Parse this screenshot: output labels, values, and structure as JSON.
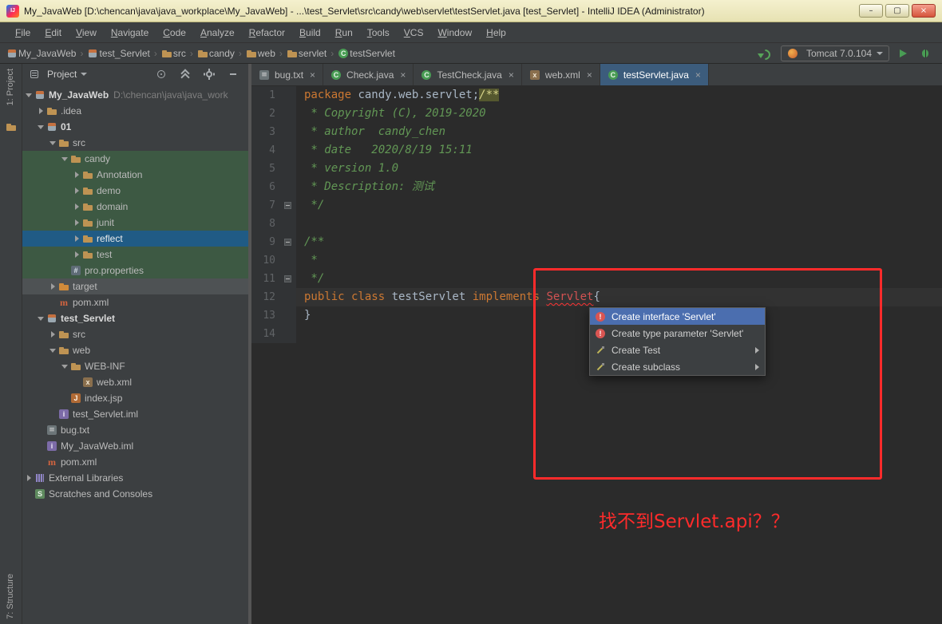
{
  "window": {
    "title": "My_JavaWeb [D:\\chencan\\java\\java_workplace\\My_JavaWeb] - ...\\test_Servlet\\src\\candy\\web\\servlet\\testServlet.java [test_Servlet] - IntelliJ IDEA (Administrator)",
    "controls": {
      "minimize": "–",
      "maximize": "▢",
      "close": "×"
    }
  },
  "menu_bar": {
    "items": [
      "File",
      "Edit",
      "View",
      "Navigate",
      "Code",
      "Analyze",
      "Refactor",
      "Build",
      "Run",
      "Tools",
      "VCS",
      "Window",
      "Help"
    ]
  },
  "nav_bar": {
    "breadcrumbs": [
      {
        "label": "My_JavaWeb",
        "icon": "module"
      },
      {
        "label": "test_Servlet",
        "icon": "module"
      },
      {
        "label": "src",
        "icon": "folder"
      },
      {
        "label": "candy",
        "icon": "folder"
      },
      {
        "label": "web",
        "icon": "folder"
      },
      {
        "label": "servlet",
        "icon": "folder"
      },
      {
        "label": "testServlet",
        "icon": "class"
      }
    ],
    "right": {
      "pre_icons": [
        "green-arrow"
      ],
      "run_config": {
        "label": "Tomcat 7.0.104",
        "icon": "tomcat"
      },
      "post_icons": [
        "run",
        "debug"
      ]
    }
  },
  "tool_windows": {
    "left_top": "1: Project",
    "left_bottom": "7: Structure"
  },
  "project_panel": {
    "header": {
      "icon": "project-view",
      "title": "Project",
      "actions": [
        "locate",
        "collapse-all",
        "settings",
        "hide"
      ]
    },
    "tree": [
      {
        "label": "My_JavaWeb",
        "hint": "D:\\chencan\\java\\java_work",
        "indent": 0,
        "icon": "module",
        "arrow": "down",
        "bold": true
      },
      {
        "label": ".idea",
        "indent": 1,
        "icon": "folder",
        "arrow": "right"
      },
      {
        "label": "01",
        "indent": 1,
        "icon": "module",
        "arrow": "down",
        "bold": true
      },
      {
        "label": "src",
        "indent": 2,
        "icon": "folder",
        "arrow": "down"
      },
      {
        "label": "candy",
        "indent": 3,
        "icon": "folder",
        "arrow": "down",
        "highlight": "green"
      },
      {
        "label": "Annotation",
        "indent": 4,
        "icon": "folder",
        "arrow": "right",
        "highlight": "green"
      },
      {
        "label": "demo",
        "indent": 4,
        "icon": "folder",
        "arrow": "right",
        "highlight": "green"
      },
      {
        "label": "domain",
        "indent": 4,
        "icon": "folder",
        "arrow": "right",
        "highlight": "green"
      },
      {
        "label": "junit",
        "indent": 4,
        "icon": "folder",
        "arrow": "right",
        "highlight": "green"
      },
      {
        "label": "reflect",
        "indent": 4,
        "icon": "folder",
        "arrow": "right",
        "highlight": "blue"
      },
      {
        "label": "test",
        "indent": 4,
        "icon": "folder",
        "arrow": "right",
        "highlight": "green"
      },
      {
        "label": "pro.properties",
        "indent": 3,
        "icon": "properties",
        "highlight": "green"
      },
      {
        "label": "target",
        "indent": 2,
        "icon": "folder-orange",
        "arrow": "right",
        "highlight": "gray"
      },
      {
        "label": "pom.xml",
        "indent": 2,
        "icon": "maven"
      },
      {
        "label": "test_Servlet",
        "indent": 1,
        "icon": "module",
        "arrow": "down",
        "bold": true
      },
      {
        "label": "src",
        "indent": 2,
        "icon": "folder",
        "arrow": "right"
      },
      {
        "label": "web",
        "indent": 2,
        "icon": "folder",
        "arrow": "down"
      },
      {
        "label": "WEB-INF",
        "indent": 3,
        "icon": "folder",
        "arrow": "down"
      },
      {
        "label": "web.xml",
        "indent": 4,
        "icon": "xml"
      },
      {
        "label": "index.jsp",
        "indent": 3,
        "icon": "jsp"
      },
      {
        "label": "test_Servlet.iml",
        "indent": 2,
        "icon": "iml"
      },
      {
        "label": "bug.txt",
        "indent": 1,
        "icon": "text"
      },
      {
        "label": "My_JavaWeb.iml",
        "indent": 1,
        "icon": "iml"
      },
      {
        "label": "pom.xml",
        "indent": 1,
        "icon": "maven"
      },
      {
        "label": "External Libraries",
        "indent": 0,
        "icon": "libraries",
        "arrow": "right"
      },
      {
        "label": "Scratches and Consoles",
        "indent": 0,
        "icon": "scratches"
      }
    ]
  },
  "editor": {
    "tabs": [
      {
        "label": "bug.txt",
        "icon": "text",
        "active": false
      },
      {
        "label": "Check.java",
        "icon": "class",
        "active": false
      },
      {
        "label": "TestCheck.java",
        "icon": "class",
        "active": false
      },
      {
        "label": "web.xml",
        "icon": "xml",
        "active": false
      },
      {
        "label": "testServlet.java",
        "icon": "class",
        "active": true
      }
    ],
    "lines": [
      {
        "num": 1,
        "segments": [
          {
            "t": "package ",
            "c": "kw"
          },
          {
            "t": "candy.web.servlet;",
            "c": "pl"
          },
          {
            "t": "/**",
            "c": "cmhl"
          }
        ]
      },
      {
        "num": 2,
        "segments": [
          {
            "t": " * Copyright (C), 2019-2020",
            "c": "cm"
          }
        ]
      },
      {
        "num": 3,
        "segments": [
          {
            "t": " * author  candy_chen",
            "c": "cm"
          }
        ]
      },
      {
        "num": 4,
        "segments": [
          {
            "t": " * date   2020/8/19 15:11",
            "c": "cm"
          }
        ]
      },
      {
        "num": 5,
        "segments": [
          {
            "t": " * version 1.0",
            "c": "cm"
          }
        ]
      },
      {
        "num": 6,
        "segments": [
          {
            "t": " * Description: 测试",
            "c": "cm"
          }
        ]
      },
      {
        "num": 7,
        "segments": [
          {
            "t": " */",
            "c": "cm"
          }
        ],
        "fold": true
      },
      {
        "num": 8,
        "segments": []
      },
      {
        "num": 9,
        "segments": [
          {
            "t": "/**",
            "c": "cm"
          }
        ],
        "fold": true
      },
      {
        "num": 10,
        "segments": [
          {
            "t": " *",
            "c": "cm"
          }
        ]
      },
      {
        "num": 11,
        "segments": [
          {
            "t": " */",
            "c": "cm"
          }
        ],
        "fold": true
      },
      {
        "num": 12,
        "segments": [
          {
            "t": "public class ",
            "c": "kw"
          },
          {
            "t": "testServlet ",
            "c": "pl"
          },
          {
            "t": "implements ",
            "c": "kw"
          },
          {
            "t": "Servlet",
            "c": "err"
          },
          {
            "t": "{",
            "c": "pl"
          }
        ],
        "current": true
      },
      {
        "num": 13,
        "segments": [
          {
            "t": "}",
            "c": "pl"
          }
        ]
      },
      {
        "num": 14,
        "segments": []
      }
    ]
  },
  "popup": {
    "items": [
      {
        "label": "Create interface 'Servlet'",
        "icon": "fix-error",
        "selected": true,
        "submenu": false
      },
      {
        "label": "Create type parameter 'Servlet'",
        "icon": "fix-error",
        "selected": false,
        "submenu": false
      },
      {
        "label": "Create Test",
        "icon": "fix-action",
        "selected": false,
        "submenu": true
      },
      {
        "label": "Create subclass",
        "icon": "fix-action",
        "selected": false,
        "submenu": true
      }
    ]
  },
  "annotations": {
    "note": "找不到Servlet.api？？"
  },
  "colors": {
    "titlebar": "#EFEBC2",
    "panel_bg": "#3C3F41",
    "editor_bg": "#2B2B2B",
    "selection_blue": "#205B85",
    "row_green": "#3D5943",
    "keyword_orange": "#CC7832",
    "comment_green": "#629755",
    "error_red": "#D25252",
    "annotation_red": "#FF2B2B",
    "run_green": "#499C54"
  }
}
